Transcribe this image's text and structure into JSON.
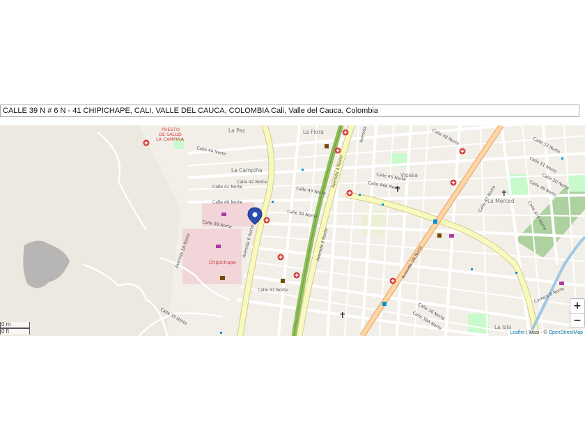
{
  "address": {
    "text": "CALLE 39 N # 6 N - 41  CHIPICHAPE, CALI, VALLE DEL CAUCA, COLOMBIA Cali, Valle del Cauca, Colombia"
  },
  "map": {
    "places": {
      "la_paz": "La Paz",
      "la_flora": "La Flora",
      "la_campina": "La Campiña",
      "vipasa": "Vipasa",
      "la_merced": "La Merced",
      "chipichape": "Chipichape",
      "la_isla": "La Isla",
      "puesto_salud_1": "PUESTO",
      "puesto_salud_2": "DE SALUD",
      "puesto_salud_3": "LA CAMPIÑA"
    },
    "streets": {
      "calle_44_norte": "Calle 44 Norte",
      "calle_42_norte": "Calle 42 Norte",
      "calle_41_norte": "Calle 41 Norte",
      "calle_40_norte": "Calle 40 Norte",
      "calle_38_norte": "Calle 38 Norte",
      "calle_37_norte": "Calle 37 Norte",
      "calle_35_norte": "Calle 35 Norte",
      "calle_45_norte": "Calle 45 Norte",
      "calle_44a_norte": "Calle 44A Norte",
      "calle_43_norte": "Calle 43 Norte",
      "calle_39_norte": "Calle 39 Norte",
      "calle_38a_norte": "Calle 38A Norte",
      "calle_36_norte": "Calle 36 Norte",
      "calle_47a_norte": "Calle 47A Norte",
      "calle_48_norte": "Calle 48 Norte",
      "calle_52_norte": "Calle 52 Norte",
      "calle_51_norte": "Calle 51 Norte",
      "calle_50_norte": "Calle 50 Norte",
      "calle_49_norte": "Calle 49 Norte",
      "calle_47_norte": "Calle 47 Norte",
      "avenida_6_norte": "Avenida 6 Norte",
      "avenida_4_norte": "Avenida 4 Norte",
      "avenida_3_norte": "Avenida 3 Norte",
      "avenida_2_norte": "Avenida 2 Norte",
      "avenida_3n_norte": "Avenida 3N Norte",
      "carrera_6_norte": "Carrera 6 Norte",
      "avenida_5a_norte": "Avenida 5A Norte"
    },
    "scale": {
      "meters": "0 m",
      "feet": "0 ft"
    },
    "attribution": {
      "leaflet": "Leaflet",
      "separator1": " | Wasi - © ",
      "osm": "OpenStreetMap"
    },
    "zoom": {
      "zoom_in": "+",
      "zoom_out": "−"
    },
    "colors": {
      "land": "#f2efe9",
      "park": "#c8facc",
      "primary_road": "#fcd6a4",
      "secondary_road": "#f7fabf",
      "major_road": "#e892a2",
      "trunk": "#8fbf5c",
      "marker": "#2a4db0"
    }
  }
}
